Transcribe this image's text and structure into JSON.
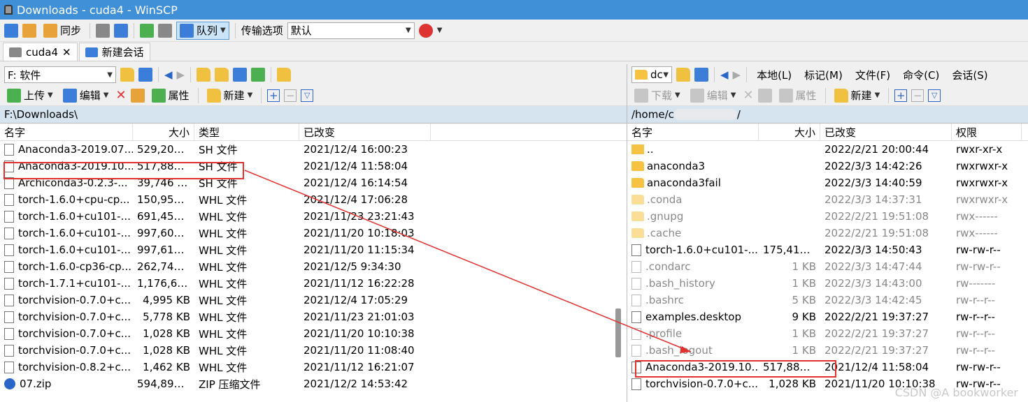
{
  "window": {
    "title": "Downloads - cuda4 - WinSCP"
  },
  "toolbar": {
    "sync_label": "同步",
    "queue_label": "队列",
    "transfer_options_label": "传输选项",
    "transfer_value": "默认"
  },
  "tabs": [
    {
      "label": "cuda4"
    },
    {
      "label": "新建会话"
    }
  ],
  "left": {
    "drive": "F: 软件",
    "actions": {
      "upload": "上传",
      "edit": "编辑",
      "properties": "属性",
      "new": "新建"
    },
    "path": "F:\\Downloads\\",
    "columns": [
      "名字",
      "大小",
      "类型",
      "已改变"
    ],
    "files": [
      {
        "name": "Anaconda3-2019.07...",
        "size": "529,206 ...",
        "type": "SH 文件",
        "changed": "2021/12/4  16:00:23"
      },
      {
        "name": "Anaconda3-2019.10...",
        "size": "517,880 ...",
        "type": "SH 文件",
        "changed": "2021/12/4  11:58:04"
      },
      {
        "name": "Archiconda3-0.2.3-...",
        "size": "39,746 KB",
        "type": "SH 文件",
        "changed": "2021/12/4  16:14:54"
      },
      {
        "name": "torch-1.6.0+cpu-cp...",
        "size": "150,955 ...",
        "type": "WHL 文件",
        "changed": "2021/12/4  17:06:28"
      },
      {
        "name": "torch-1.6.0+cu101-...",
        "size": "691,450 ...",
        "type": "WHL 文件",
        "changed": "2021/11/23  23:21:43"
      },
      {
        "name": "torch-1.6.0+cu101-...",
        "size": "997,609 ...",
        "type": "WHL 文件",
        "changed": "2021/11/20  10:18:03"
      },
      {
        "name": "torch-1.6.0+cu101-...",
        "size": "997,611 ...",
        "type": "WHL 文件",
        "changed": "2021/11/20  11:15:34"
      },
      {
        "name": "torch-1.6.0-cp36-cp...",
        "size": "262,744 ...",
        "type": "WHL 文件",
        "changed": "2021/12/5  9:34:30"
      },
      {
        "name": "torch-1.7.1+cu101-...",
        "size": "1,176,60...",
        "type": "WHL 文件",
        "changed": "2021/11/12  16:22:28"
      },
      {
        "name": "torchvision-0.7.0+c...",
        "size": "4,995 KB",
        "type": "WHL 文件",
        "changed": "2021/12/4  17:05:29"
      },
      {
        "name": "torchvision-0.7.0+c...",
        "size": "5,778 KB",
        "type": "WHL 文件",
        "changed": "2021/11/23  21:01:03"
      },
      {
        "name": "torchvision-0.7.0+c...",
        "size": "1,028 KB",
        "type": "WHL 文件",
        "changed": "2021/11/20  10:10:38"
      },
      {
        "name": "torchvision-0.7.0+c...",
        "size": "1,028 KB",
        "type": "WHL 文件",
        "changed": "2021/11/20  11:08:40"
      },
      {
        "name": "torchvision-0.8.2+c...",
        "size": "1,462 KB",
        "type": "WHL 文件",
        "changed": "2021/11/12  16:21:07"
      },
      {
        "name": "07.zip",
        "size": "594,896 ...",
        "type": "ZIP 压缩文件",
        "changed": "2021/12/2  14:53:42"
      }
    ]
  },
  "right": {
    "folder": "dc",
    "menu": [
      "本地(L)",
      "标记(M)",
      "文件(F)",
      "命令(C)",
      "会话(S)"
    ],
    "actions": {
      "download": "下载",
      "edit": "编辑",
      "properties": "属性",
      "new": "新建"
    },
    "path_prefix": "/home/c",
    "path_suffix": "/",
    "columns": [
      "名字",
      "大小",
      "已改变",
      "权限"
    ],
    "files": [
      {
        "name": "..",
        "size": "",
        "changed": "2022/2/21 20:00:44",
        "perm": "rwxr-xr-x",
        "kind": "up"
      },
      {
        "name": "anaconda3",
        "size": "",
        "changed": "2022/3/3 14:42:26",
        "perm": "rwxrwxr-x",
        "kind": "folder"
      },
      {
        "name": "anaconda3fail",
        "size": "",
        "changed": "2022/3/3 14:40:59",
        "perm": "rwxrwxr-x",
        "kind": "folder"
      },
      {
        "name": ".conda",
        "size": "",
        "changed": "2022/3/3 14:37:31",
        "perm": "rwxrwxr-x",
        "kind": "folder",
        "hidden": true
      },
      {
        "name": ".gnupg",
        "size": "",
        "changed": "2022/2/21 19:51:08",
        "perm": "rwx------",
        "kind": "folder",
        "hidden": true
      },
      {
        "name": ".cache",
        "size": "",
        "changed": "2022/2/21 19:51:08",
        "perm": "rwx------",
        "kind": "folder",
        "hidden": true
      },
      {
        "name": "torch-1.6.0+cu101-...",
        "size": "175,413 ...",
        "changed": "2022/3/3 14:50:43",
        "perm": "rw-rw-r--",
        "kind": "file"
      },
      {
        "name": ".condarc",
        "size": "1 KB",
        "changed": "2022/3/3 14:47:44",
        "perm": "rw-rw-r--",
        "kind": "file",
        "hidden": true
      },
      {
        "name": ".bash_history",
        "size": "1 KB",
        "changed": "2022/3/3 14:43:00",
        "perm": "rw-------",
        "kind": "file",
        "hidden": true
      },
      {
        "name": ".bashrc",
        "size": "5 KB",
        "changed": "2022/3/3 14:42:45",
        "perm": "rw-r--r--",
        "kind": "file",
        "hidden": true
      },
      {
        "name": "examples.desktop",
        "size": "9 KB",
        "changed": "2022/2/21 19:37:27",
        "perm": "rw-r--r--",
        "kind": "file"
      },
      {
        "name": ".profile",
        "size": "1 KB",
        "changed": "2022/2/21 19:37:27",
        "perm": "rw-r--r--",
        "kind": "file",
        "hidden": true
      },
      {
        "name": ".bash_logout",
        "size": "1 KB",
        "changed": "2022/2/21 19:37:27",
        "perm": "rw-r--r--",
        "kind": "file",
        "hidden": true
      },
      {
        "name": "Anaconda3-2019.10...",
        "size": "517,880 ...",
        "changed": "2021/12/4 11:58:04",
        "perm": "rw-rw-r--",
        "kind": "file"
      },
      {
        "name": "torchvision-0.7.0+c...",
        "size": "1,028 KB",
        "changed": "2021/11/20 10:10:38",
        "perm": "rw-rw-r--",
        "kind": "file"
      }
    ]
  },
  "watermark": "CSDN @A bookworker",
  "colors": {
    "titlebar": "#4090d8",
    "highlight": "#e0312f",
    "path_bg": "#d6e4f0"
  }
}
